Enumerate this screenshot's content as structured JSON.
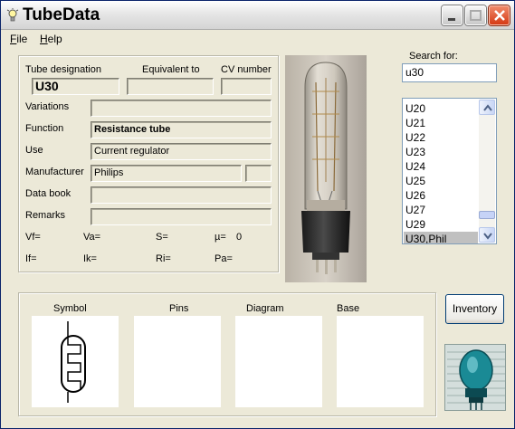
{
  "window": {
    "title": "TubeData"
  },
  "menu": {
    "file": "File",
    "help": "Help"
  },
  "details": {
    "tube_designation_label": "Tube designation",
    "equivalent_label": "Equivalent to",
    "cv_label": "CV number",
    "tube_designation": "U30",
    "equivalent": "",
    "cv_number": "",
    "variations_label": "Variations",
    "variations": "",
    "function_label": "Function",
    "function": "Resistance tube",
    "use_label": "Use",
    "use": "Current regulator",
    "manufacturer_label": "Manufacturer",
    "manufacturer": "Philips",
    "manufacturer_code": "",
    "data_book_label": "Data book",
    "data_book": "",
    "remarks_label": "Remarks",
    "remarks": "",
    "params": {
      "vf": "Vf=",
      "va": "Va=",
      "s": "S=",
      "mu": "µ=",
      "mu_value": "0",
      "if": "If=",
      "ik": "Ik=",
      "ri": "Ri=",
      "pa": "Pa="
    }
  },
  "search": {
    "label": "Search for:",
    "value": "u30",
    "results": [
      "U20",
      "U21",
      "U22",
      "U23",
      "U24",
      "U25",
      "U26",
      "U27",
      "U29",
      "U30,Phil"
    ],
    "selected": "U30,Phil"
  },
  "bottom": {
    "symbol_label": "Symbol",
    "pins_label": "Pins",
    "diagram_label": "Diagram",
    "base_label": "Base",
    "inventory_button": "Inventory"
  },
  "colors": {
    "selection": "#c0c0c0",
    "window_bg": "#ece9d8",
    "close_button": "#d53a15"
  },
  "icons": [
    "lamp-icon",
    "minimize-icon",
    "maximize-icon",
    "close-icon",
    "scroll-up-icon",
    "scroll-down-icon"
  ]
}
